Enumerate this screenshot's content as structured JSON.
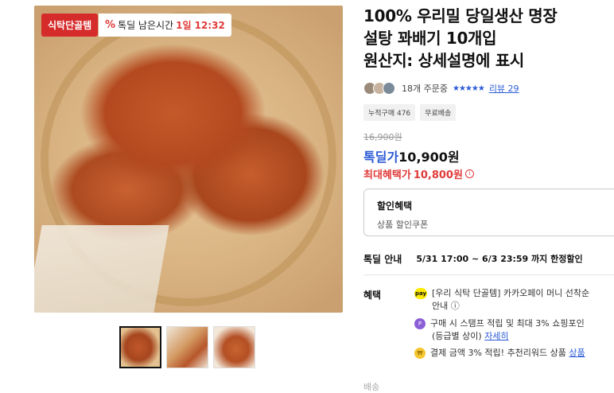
{
  "image": {
    "brand_badge": "식탁단골템",
    "deal_badge": {
      "pct": "%",
      "label": "톡딜 남은시간",
      "time": "1일 12:32"
    }
  },
  "thumbnails": [
    "thumb-1",
    "thumb-2",
    "thumb-3"
  ],
  "product": {
    "title_lines": [
      "100% 우리밀 당일생산 명장",
      "설탕 꽈배기 10개입",
      "원산지: 상세설명에 표시"
    ]
  },
  "reviews": {
    "orders": "18개 주문중",
    "stars": "★★★★★",
    "review_link": "리뷰 29"
  },
  "chips": [
    "누적구매 476",
    "무료배송"
  ],
  "price": {
    "original": "16,900원",
    "deal_label": "톡딜가",
    "deal_value": "10,900원",
    "max_label": "최대혜택가",
    "max_value": "10,800원",
    "info_icon": "i"
  },
  "discount": {
    "heading": "할인혜택",
    "sub": "상품 할인쿠폰"
  },
  "deal_info": {
    "label": "톡딜 안내",
    "value": "5/31 17:00 ~ 6/3 23:59 까지 한정할인"
  },
  "benefits": {
    "label": "혜택",
    "items": [
      {
        "icon": "pay",
        "line1": "[우리 식탁 단골템] 카카오페이 머니 선착순",
        "line2": "안내 ⓘ"
      },
      {
        "icon": "P",
        "line1": "구매 시 스탬프 적립 및 최대 3% 쇼핑포인",
        "line2_text": "(등급별 상이)",
        "line2_link": "자세히"
      },
      {
        "icon": "₩",
        "line1": "결제 금액 3% 적립! 추천리워드 상품",
        "link": "상품"
      }
    ]
  },
  "cutoff_text": "배송"
}
